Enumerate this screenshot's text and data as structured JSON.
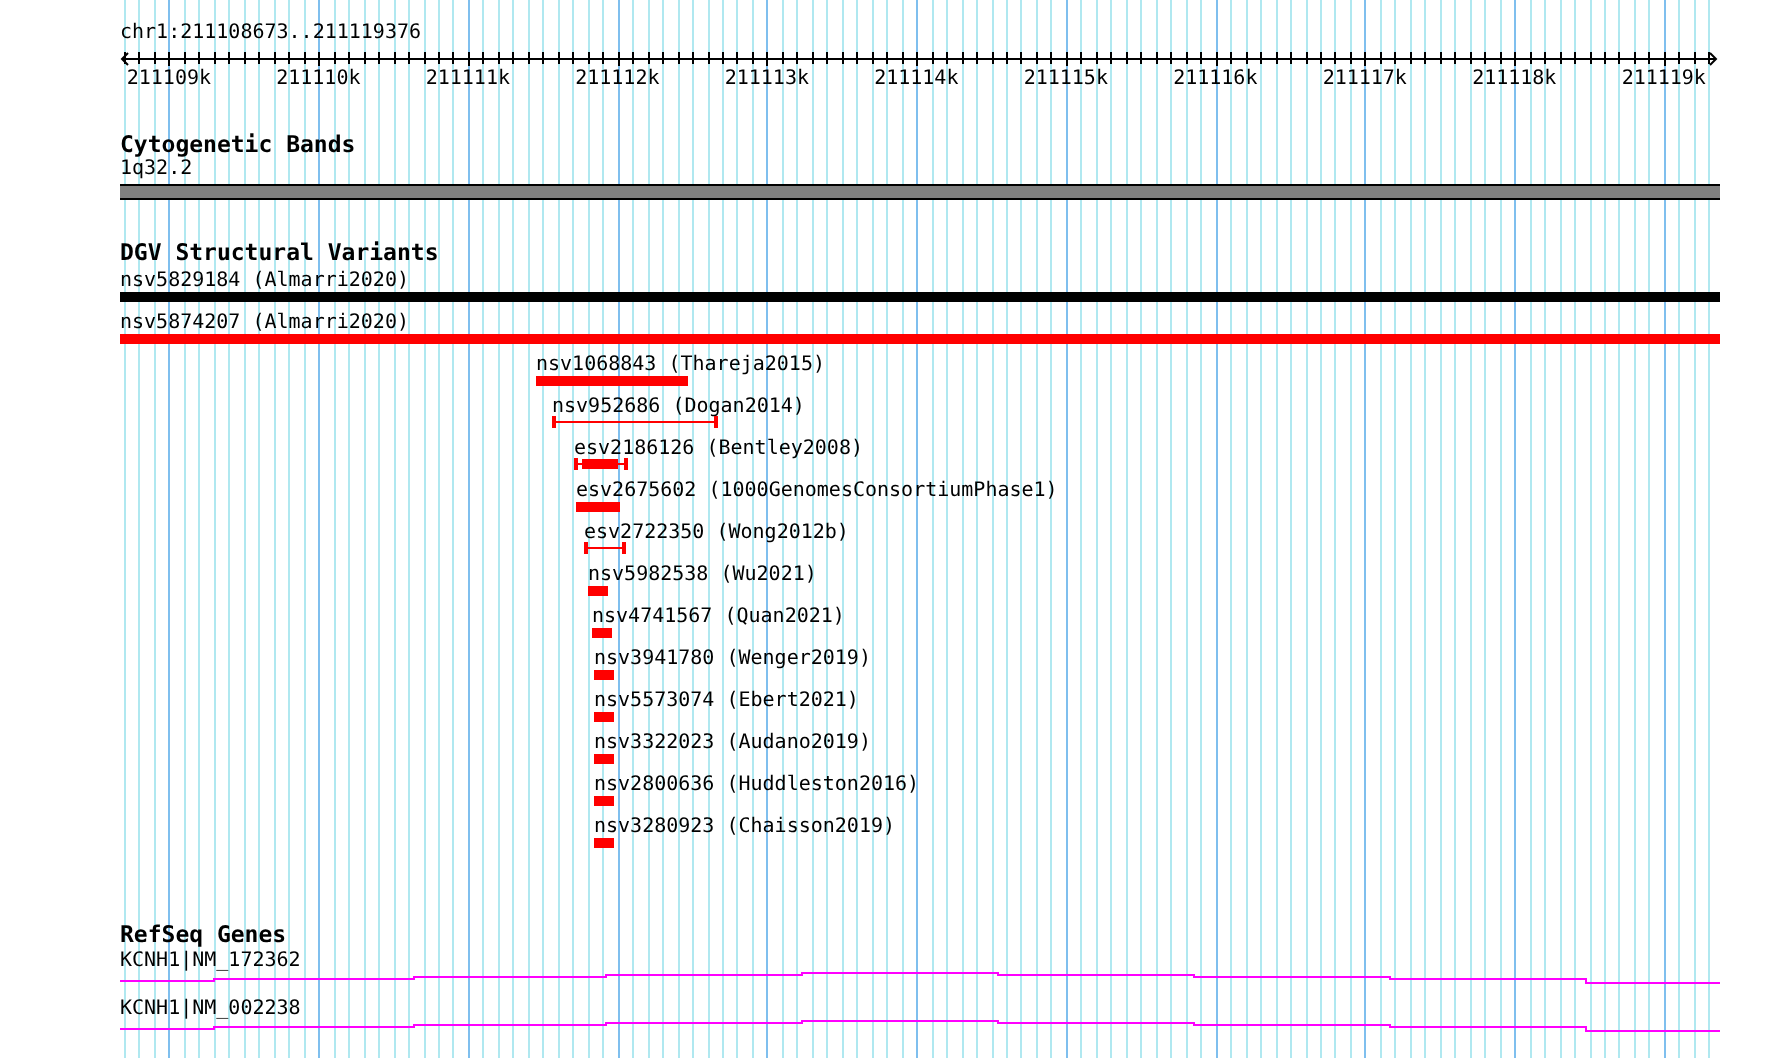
{
  "location": "chr1:211108673..211119376",
  "ruler": {
    "ticks": [
      "211109k",
      "211110k",
      "211111k",
      "211112k",
      "211113k",
      "211114k",
      "211115k",
      "211116k",
      "211117k",
      "211118k",
      "211119k"
    ]
  },
  "tracks": [
    {
      "kind": "bands",
      "title": "Cytogenetic Bands",
      "features": [
        {
          "label": "1q32.2"
        }
      ]
    },
    {
      "kind": "variants",
      "title": "DGV Structural Variants",
      "features": [
        {
          "label": "nsv5829184 (Almarri2020)",
          "kind": "bar",
          "color": "#000000"
        },
        {
          "label": "nsv5874207 (Almarri2020)",
          "kind": "bar",
          "color": "#ff0000"
        },
        {
          "label": "nsv1068843 (Thareja2015)",
          "kind": "bar",
          "color": "#ff0000"
        },
        {
          "label": "nsv952686 (Dogan2014)",
          "kind": "interval",
          "color": "#ff0000"
        },
        {
          "label": "esv2186126 (Bentley2008)",
          "kind": "capped-bar",
          "color": "#ff0000"
        },
        {
          "label": "esv2675602 (1000GenomesConsortiumPhase1)",
          "kind": "bar",
          "color": "#ff0000"
        },
        {
          "label": "esv2722350 (Wong2012b)",
          "kind": "interval",
          "color": "#ff0000"
        },
        {
          "label": "nsv5982538 (Wu2021)",
          "kind": "bar",
          "color": "#ff0000"
        },
        {
          "label": "nsv4741567 (Quan2021)",
          "kind": "bar",
          "color": "#ff0000"
        },
        {
          "label": "nsv3941780 (Wenger2019)",
          "kind": "bar",
          "color": "#ff0000"
        },
        {
          "label": "nsv5573074 (Ebert2021)",
          "kind": "bar",
          "color": "#ff0000"
        },
        {
          "label": "nsv3322023 (Audano2019)",
          "kind": "bar",
          "color": "#ff0000"
        },
        {
          "label": "nsv2800636 (Huddleston2016)",
          "kind": "bar",
          "color": "#ff0000"
        },
        {
          "label": "nsv3280923 (Chaisson2019)",
          "kind": "bar",
          "color": "#ff0000"
        }
      ]
    },
    {
      "kind": "genes",
      "title": "RefSeq Genes",
      "features": [
        {
          "label": "KCNH1|NM_172362"
        },
        {
          "label": "KCNH1|NM_002238"
        }
      ]
    }
  ]
}
